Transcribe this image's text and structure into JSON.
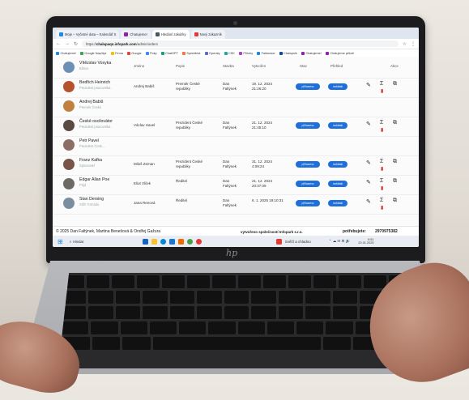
{
  "browser": {
    "tabs": [
      {
        "label": "Moje – Vyčetné data – Kalendář S",
        "color": "#1e88e5",
        "active": false
      },
      {
        "label": "Chatujeme!",
        "color": "#8e24aa",
        "active": false
      },
      {
        "label": "Hledání zakázky",
        "color": "#455a64",
        "active": true
      },
      {
        "label": "Nový zákazník",
        "color": "#e53935",
        "active": false
      }
    ],
    "url_prefix": "https://",
    "url_host": "chalupaqo.infopark.com",
    "url_path": "/admin/orders",
    "bookmarks": [
      "Chatujeme!",
      "Google Nap/Apr",
      "Firma",
      "Google",
      "Poky",
      "ChatGPT",
      "Speedtest",
      "Operaty",
      "CSK",
      "Přílohy",
      "Fakturace",
      "Chalupnik",
      "Chatujeme!",
      "Chatujeme pěkně"
    ]
  },
  "table": {
    "headers": [
      "Jméno",
      "Popis",
      "Stavba",
      "Vytvořen",
      "Stav",
      "Přehled",
      "Akce"
    ],
    "rows": [
      {
        "user": "Vítězslav Vosyka",
        "role": "Bůsce",
        "avatar_color": "#6b8fb5",
        "jmeno": "",
        "popis": "",
        "stavba": "",
        "vytvoren": "",
        "status": "",
        "overview": ""
      },
      {
        "user": "Bedřich Heinrich",
        "role": "Prezident pracovníka",
        "avatar_color": "#b5532f",
        "jmeno": "Andrej Babiš",
        "popis": "Premiér České\nrepubliky",
        "stavba": "Dan\nFaltýnek",
        "vytvoren": "19. 12. 2024\n21:26:20",
        "status": "přiřazeno",
        "overview": "nahlásit"
      },
      {
        "user": "Andrej Babiš",
        "role": "Premiér České",
        "avatar_color": "#c0803f",
        "jmeno": "",
        "popis": "",
        "stavba": "",
        "vytvoren": "",
        "status": "",
        "overview": ""
      },
      {
        "user": "České oscilovátor",
        "role": "Prezident pracovníka",
        "avatar_color": "#5a4b42",
        "jmeno": "Václav Havel",
        "popis": "Prezident České\nrepubliky",
        "stavba": "Dan\nFaltýnek",
        "vytvoren": "21. 12. 2024\n21:45:10",
        "status": "přiřazeno",
        "overview": "nahlásit"
      },
      {
        "user": "Petr Pavel",
        "role": "Prezident Česk...",
        "avatar_color": "#8d6e63",
        "jmeno": "",
        "popis": "",
        "stavba": "",
        "vytvoren": "",
        "status": "",
        "overview": ""
      },
      {
        "user": "Franz Kafka",
        "role": "Spisovatel",
        "avatar_color": "#795548",
        "jmeno": "Miloš Zeman",
        "popis": "Prezident České\nrepubliky",
        "stavba": "Dan\nFaltýnek",
        "vytvoren": "31. 12. 2024\n4:09:24",
        "status": "přiřazeno",
        "overview": "nahlásit"
      },
      {
        "user": "Edgar Allan Poe",
        "role": "Prijd",
        "avatar_color": "#6d6a66",
        "jmeno": "Eliot Vlček",
        "popis": "Ředitel",
        "stavba": "Dan\nFaltýnek",
        "vytvoren": "21. 12. 2024\n20:37:09",
        "status": "přiřazeno",
        "overview": "nahlásit"
      },
      {
        "user": "Stan Dersing",
        "role": "Střih Tornádo",
        "avatar_color": "#7b8ea0",
        "jmeno": "Jana Renová",
        "popis": "Ředitel",
        "stavba": "Dan\nFaltýnek",
        "vytvoren": "6. 1. 2025 19:10:31",
        "status": "přiřazeno",
        "overview": "nahlásit"
      }
    ]
  },
  "footer": {
    "copyright": "© 2025 Dan Faltýnek, Martina Benešová & Ondřej Gažura",
    "company": "vytvořeno společností Infopark s.r.o.",
    "contact_label": "potřebujete:",
    "contact_value": "2970975382"
  },
  "taskbar": {
    "search": "Hledat",
    "weather": "Svěží a chladno",
    "time": "9:51",
    "date": "20.01.2025"
  },
  "device_brand": "hp",
  "colors": {
    "accent": "#1e6fd9",
    "fab": "#1e88e5",
    "delete": "#d32f2f"
  }
}
